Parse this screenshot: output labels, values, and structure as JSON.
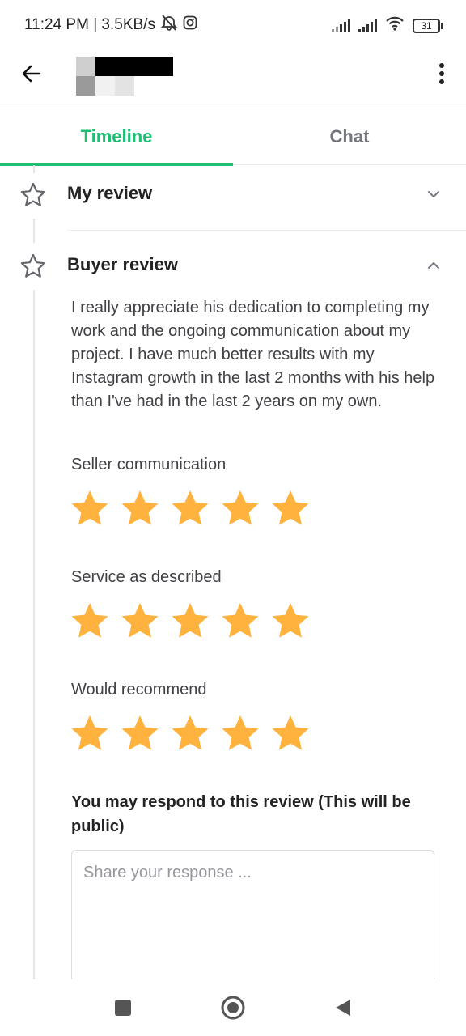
{
  "status_bar": {
    "time_speed": "11:24 PM | 3.5KB/s",
    "battery": "31",
    "icons": [
      "alarm-off-icon",
      "instagram-icon",
      "signal-icon",
      "signal-icon",
      "wifi-icon",
      "battery-icon"
    ]
  },
  "app_bar": {
    "back_icon": "arrow-left-icon",
    "menu_icon": "more-vertical-icon"
  },
  "tabs": [
    {
      "label": "Timeline",
      "active": true
    },
    {
      "label": "Chat",
      "active": false
    }
  ],
  "sections": {
    "my_review": {
      "title": "My review",
      "expanded": false
    },
    "buyer_review": {
      "title": "Buyer review",
      "expanded": true
    }
  },
  "review": {
    "text": "I really appreciate his dedication to completing my work and the ongoing communication about my project. I have much better results with my Instagram growth in the last 2 months with his help than I've had in the last 2 years on my own.",
    "ratings": [
      {
        "label": "Seller communication",
        "stars": 5,
        "max": 5
      },
      {
        "label": "Service as described",
        "stars": 5,
        "max": 5
      },
      {
        "label": "Would recommend",
        "stars": 5,
        "max": 5
      }
    ]
  },
  "response": {
    "label": "You may respond to this review (This will be public)",
    "placeholder": "Share your response ...",
    "value": ""
  },
  "colors": {
    "accent": "#1dbf73",
    "star": "#ffb33e",
    "text": "#222325"
  }
}
